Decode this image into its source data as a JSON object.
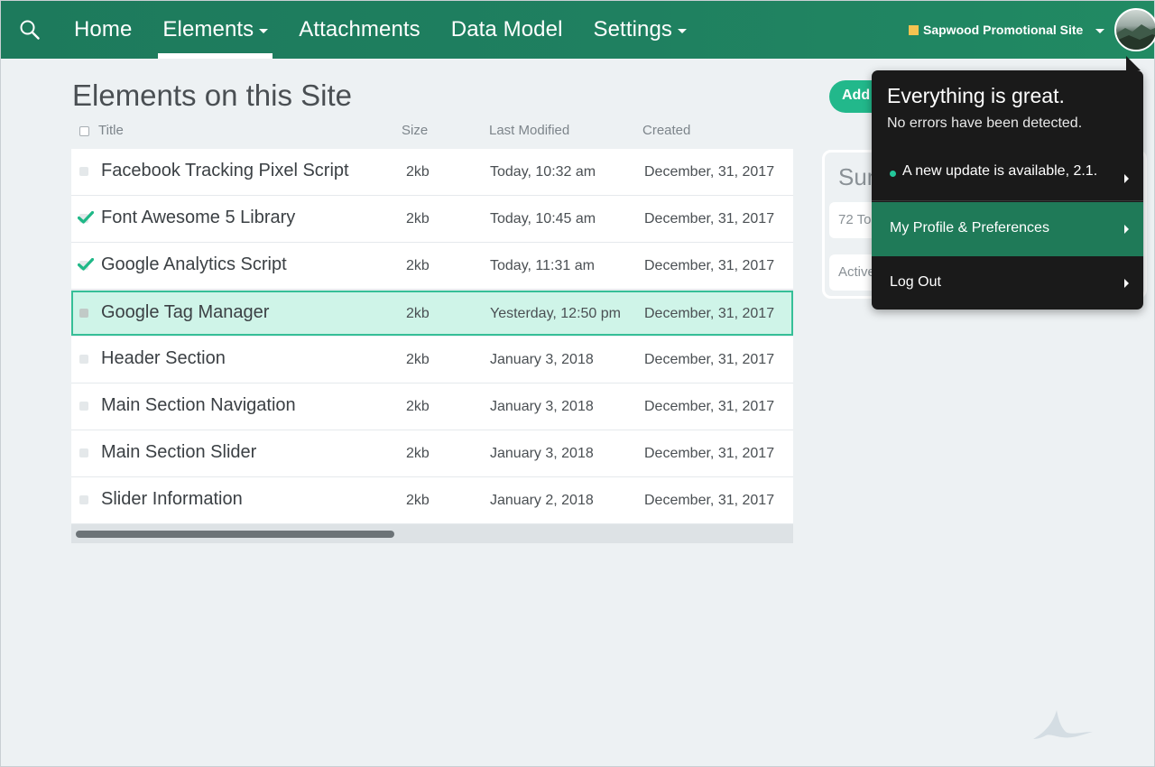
{
  "nav": {
    "items": [
      {
        "label": "Home",
        "caret": false,
        "active": false
      },
      {
        "label": "Elements",
        "caret": true,
        "active": true
      },
      {
        "label": "Attachments",
        "caret": false,
        "active": false
      },
      {
        "label": "Data Model",
        "caret": false,
        "active": false
      },
      {
        "label": "Settings",
        "caret": true,
        "active": false
      }
    ],
    "site_name": "Sapwood Promotional Site",
    "site_color": "#f4c351",
    "accent_color": "#1f8060"
  },
  "main": {
    "title": "Elements on this Site",
    "columns": [
      "Title",
      "Size",
      "Last Modified",
      "Created"
    ],
    "rows": [
      {
        "title": "Facebook Tracking Pixel Script",
        "size": "2kb",
        "modified": "Today, 10:32 am",
        "created": "December, 31, 2017",
        "checked": false,
        "selected": false
      },
      {
        "title": "Font Awesome 5 Library",
        "size": "2kb",
        "modified": "Today, 10:45 am",
        "created": "December, 31, 2017",
        "checked": true,
        "selected": false
      },
      {
        "title": "Google Analytics Script",
        "size": "2kb",
        "modified": "Today, 11:31 am",
        "created": "December, 31, 2017",
        "checked": true,
        "selected": false
      },
      {
        "title": "Google Tag Manager",
        "size": "2kb",
        "modified": "Yesterday, 12:50 pm",
        "created": "December, 31, 2017",
        "checked": false,
        "selected": true
      },
      {
        "title": "Header Section",
        "size": "2kb",
        "modified": "January 3, 2018",
        "created": "December, 31, 2017",
        "checked": false,
        "selected": false
      },
      {
        "title": "Main Section Navigation",
        "size": "2kb",
        "modified": "January 3, 2018",
        "created": "December, 31, 2017",
        "checked": false,
        "selected": false
      },
      {
        "title": "Main Section Slider",
        "size": "2kb",
        "modified": "January 3, 2018",
        "created": "December, 31, 2017",
        "checked": false,
        "selected": false
      },
      {
        "title": "Slider Information",
        "size": "2kb",
        "modified": "January 2, 2018",
        "created": "December, 31, 2017",
        "checked": false,
        "selected": false
      }
    ]
  },
  "side": {
    "add_label": "Add",
    "summary_title": "Summ",
    "stat_1": "72 To",
    "stat_2": "Actively Used in 24 Templates"
  },
  "popover": {
    "title": "Everything is great.",
    "subtitle": "No errors have been detected.",
    "update_text": "A new update is available, 2.1.",
    "profile_label": "My Profile & Preferences",
    "logout_label": "Log Out"
  },
  "icons": {
    "search": "search-icon",
    "check": "check-icon",
    "chevron": "chevron-right-icon",
    "watermark": "brand-logo-icon"
  }
}
